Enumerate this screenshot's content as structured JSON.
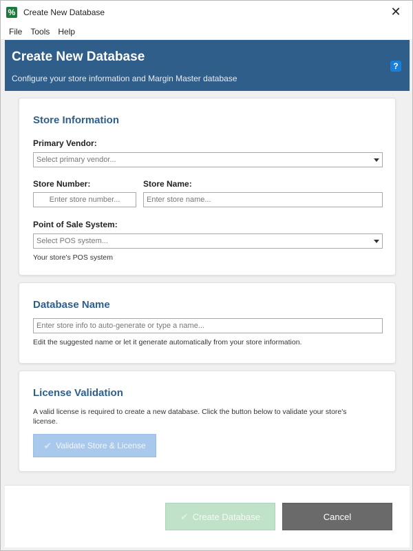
{
  "window": {
    "title": "Create New Database",
    "app_icon_glyph": "%",
    "close_glyph": "✕"
  },
  "menu": {
    "items": [
      "File",
      "Tools",
      "Help"
    ]
  },
  "header": {
    "title": "Create New Database",
    "subtitle": "Configure your store information and Margin Master database",
    "help_glyph": "?"
  },
  "store_info": {
    "title": "Store Information",
    "vendor_label": "Primary Vendor:",
    "vendor_placeholder": "Select primary vendor...",
    "store_number_label": "Store Number:",
    "store_number_placeholder": "Enter store number...",
    "store_name_label": "Store Name:",
    "store_name_placeholder": "Enter store name...",
    "pos_label": "Point of Sale System:",
    "pos_placeholder": "Select POS system...",
    "pos_help": "Your store's POS system"
  },
  "database": {
    "title": "Database Name",
    "name_placeholder": "Enter store info to auto-generate or type a name...",
    "help": "Edit the suggested name or let it generate automatically from your store information."
  },
  "license": {
    "title": "License Validation",
    "description": "A valid license is required to create a new database. Click the button below to validate your store's license.",
    "validate_label": "Validate Store & License",
    "check_glyph": "✔"
  },
  "footer": {
    "create_label": "Create Database",
    "cancel_label": "Cancel"
  },
  "colors": {
    "header_bg": "#2f5e8a",
    "accent_title": "#2f5e8a",
    "validate_disabled": "#a9c9ec",
    "create_disabled": "#bfe2c9",
    "cancel_bg": "#6a6a6a"
  }
}
